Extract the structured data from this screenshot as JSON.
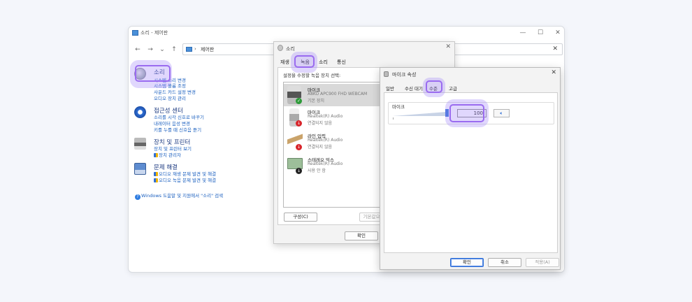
{
  "control_panel": {
    "title": "소리 - 제어판",
    "address": "제어판",
    "sections": [
      {
        "title": "소리",
        "links": [
          "시스템 소리 변경",
          "시스템 볼륨 조정",
          "사운드 카드 설정 변경",
          "오디오 장치 관리"
        ]
      },
      {
        "title": "접근성 센터",
        "links": [
          "소리를 시각 신호로 바꾸기",
          "내레이터 음성 변경",
          "키를 누를 때 신호음 듣기"
        ]
      },
      {
        "title": "장치 및 프린터",
        "links": [
          "장치 및 프린터 보기",
          "장치 관리자"
        ]
      },
      {
        "title": "문제 해결",
        "links": [
          "오디오 재생 문제 발견 및 해결",
          "오디오 녹음 문제 발견 및 해결"
        ]
      }
    ],
    "help": "Windows 도움말 및 지원에서 \"소리\" 검색"
  },
  "sound_dialog": {
    "title": "소리",
    "tabs": [
      "재생",
      "녹음",
      "소리",
      "통신"
    ],
    "description": "설정을 수정할 녹음 장치 선택:",
    "devices": [
      {
        "name": "마이크",
        "line1": "A8KO APC900 FHD WEBCAM",
        "line2": "기본 장치",
        "status": "ok"
      },
      {
        "name": "마이크",
        "line1": "Realtek(R) Audio",
        "line2": "연결되지 않음",
        "status": "off"
      },
      {
        "name": "라인 입력",
        "line1": "Realtek(R) Audio",
        "line2": "연결되지 않음",
        "status": "off"
      },
      {
        "name": "스테레오 믹스",
        "line1": "Realtek(R) Audio",
        "line2": "사용 안 함",
        "status": "disabled"
      }
    ],
    "configure_button": "구성(C)",
    "default_button": "기본값으",
    "ok_button": "확인"
  },
  "mic_dialog": {
    "title": "마이크 속성",
    "tabs": [
      "일반",
      "수신 대기",
      "수준",
      "고급"
    ],
    "group_label": "마이크",
    "level": "100",
    "level_fraction": 1.0,
    "ok_button": "확인",
    "cancel_button": "취소",
    "apply_button": "적용(A)"
  },
  "colors": {
    "highlight": "#9a6bf0",
    "link": "#1a5fbf",
    "title": "#1c3a80",
    "accent": "#2f6fd6"
  }
}
